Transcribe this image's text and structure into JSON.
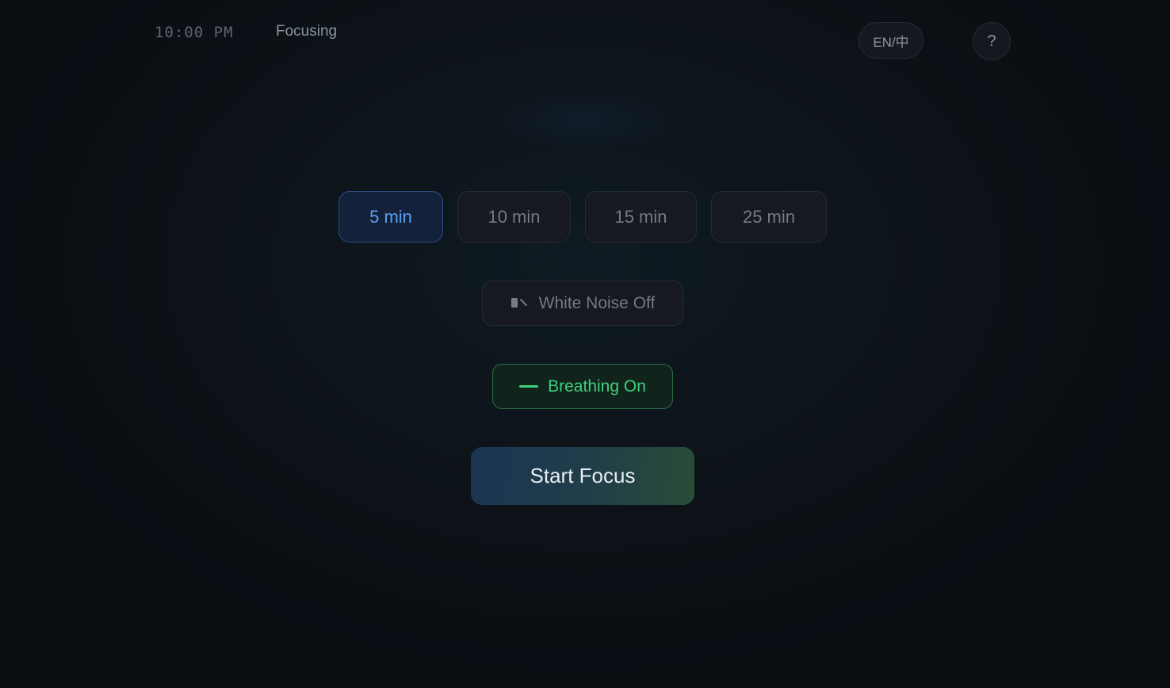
{
  "header": {
    "clock": "10:00 PM",
    "status": "Focusing",
    "lang_label": "EN/中",
    "help_label": "?"
  },
  "durations": {
    "selected": "5 min",
    "options": [
      "5 min",
      "10 min",
      "15 min",
      "25 min"
    ]
  },
  "white_noise": {
    "label": "White Noise Off",
    "state": "off",
    "icon": "speaker-muted-icon"
  },
  "breathing": {
    "label": "Breathing On",
    "state": "on",
    "icon": "breathing-line-icon"
  },
  "start": {
    "label": "Start Focus"
  },
  "colors": {
    "background": "#0b0f14",
    "accent_blue": "#5aa0f0",
    "accent_green": "#3fcf7c",
    "muted_text": "#737b87"
  }
}
